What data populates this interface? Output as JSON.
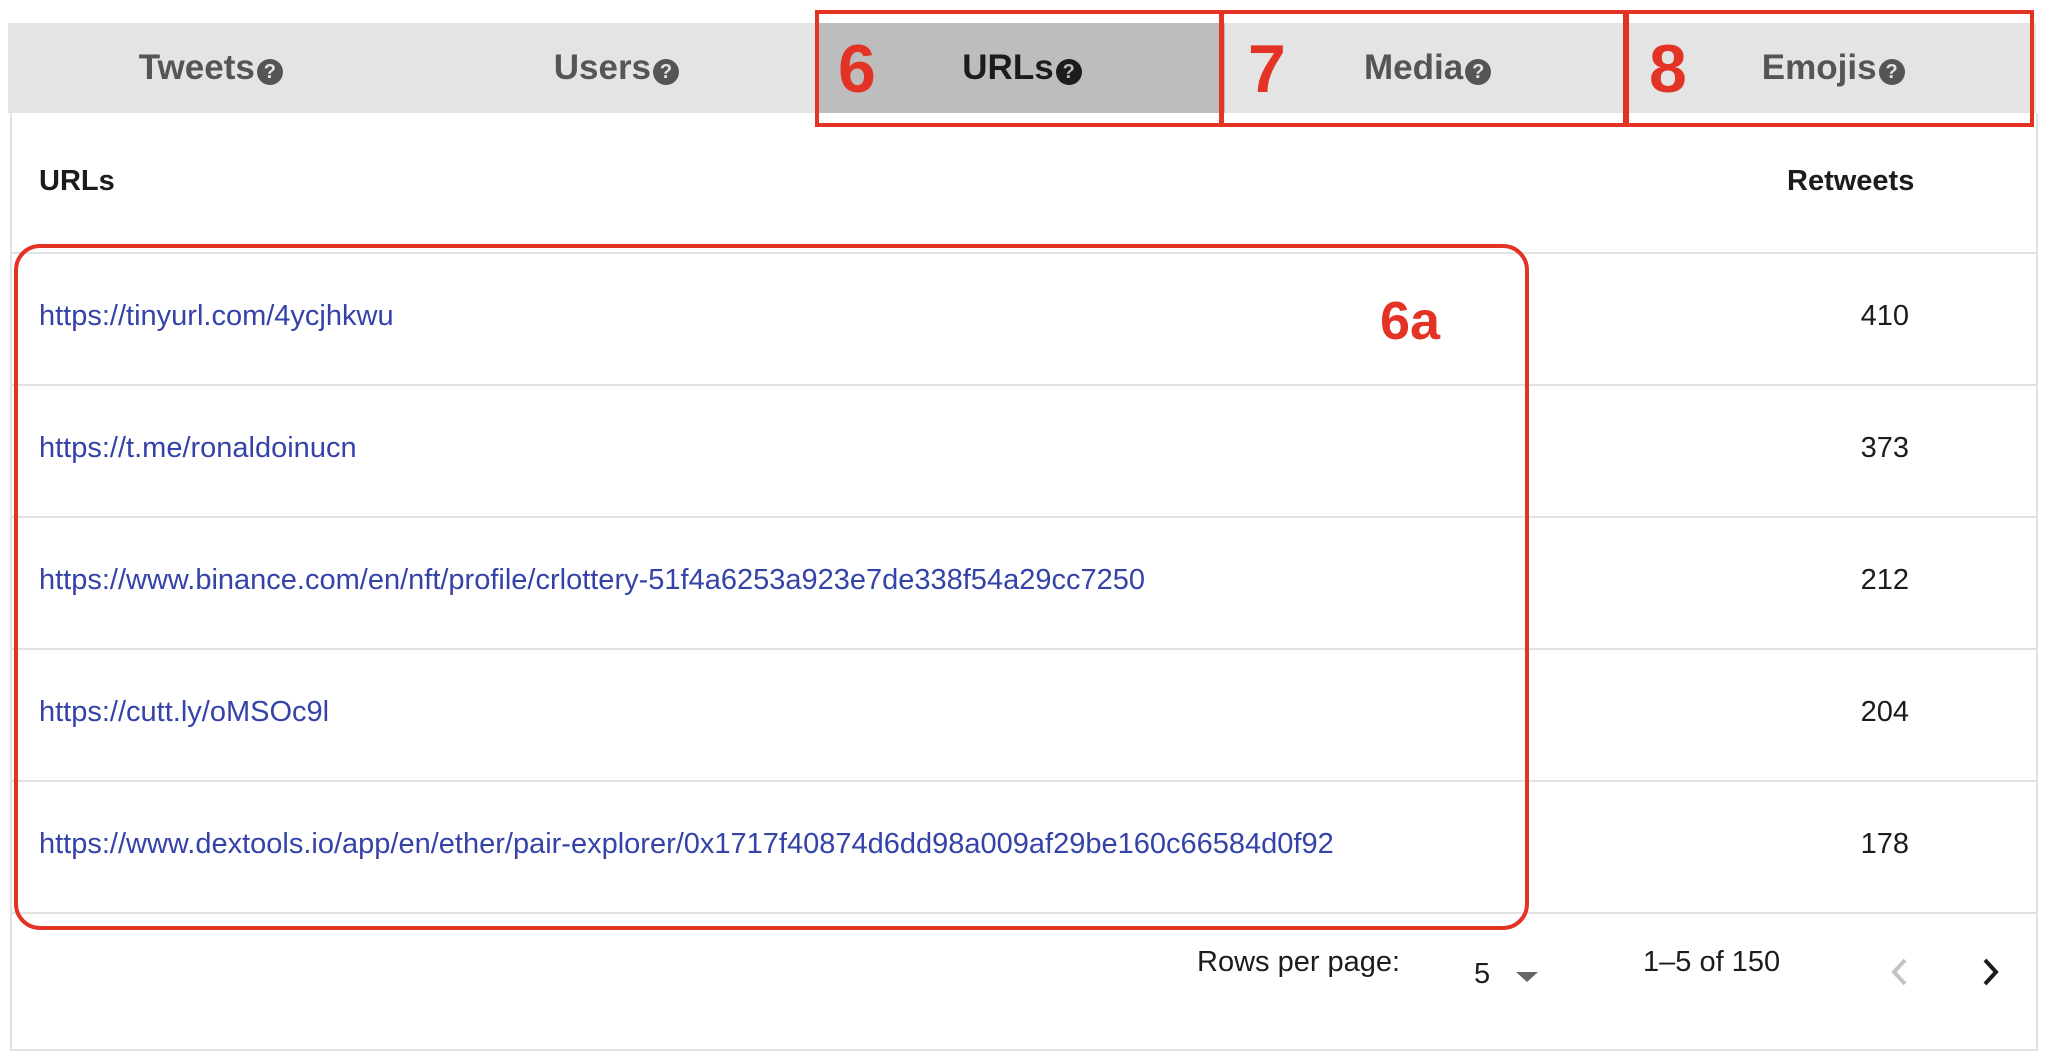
{
  "tabs": [
    {
      "label": "Tweets",
      "help": "?"
    },
    {
      "label": "Users",
      "help": "?"
    },
    {
      "label": "URLs",
      "help": "?"
    },
    {
      "label": "Media",
      "help": "?"
    },
    {
      "label": "Emojis",
      "help": "?"
    }
  ],
  "active_tab": "URLs",
  "table": {
    "headers": {
      "urls": "URLs",
      "retweets": "Retweets"
    },
    "rows": [
      {
        "url": "https://tinyurl.com/4ycjhkwu",
        "retweets": "410"
      },
      {
        "url": "https://t.me/ronaldoinucn",
        "retweets": "373"
      },
      {
        "url": "https://www.binance.com/en/nft/profile/crlottery-51f4a6253a923e7de338f54a29cc7250",
        "retweets": "212"
      },
      {
        "url": "https://cutt.ly/oMSOc9l",
        "retweets": "204"
      },
      {
        "url": "https://www.dextools.io/app/en/ether/pair-explorer/0x1717f40874d6dd98a009af29be160c66584d0f92",
        "retweets": "178"
      }
    ]
  },
  "pagination": {
    "rows_per_page_label": "Rows per page:",
    "rows_per_page_value": "5",
    "range": "1–5 of 150",
    "prev_icon": "chevron-left-icon",
    "next_icon": "chevron-right-icon"
  },
  "annotations": {
    "color": "#e23325",
    "labels": [
      "6",
      "7",
      "8",
      "6a"
    ]
  }
}
